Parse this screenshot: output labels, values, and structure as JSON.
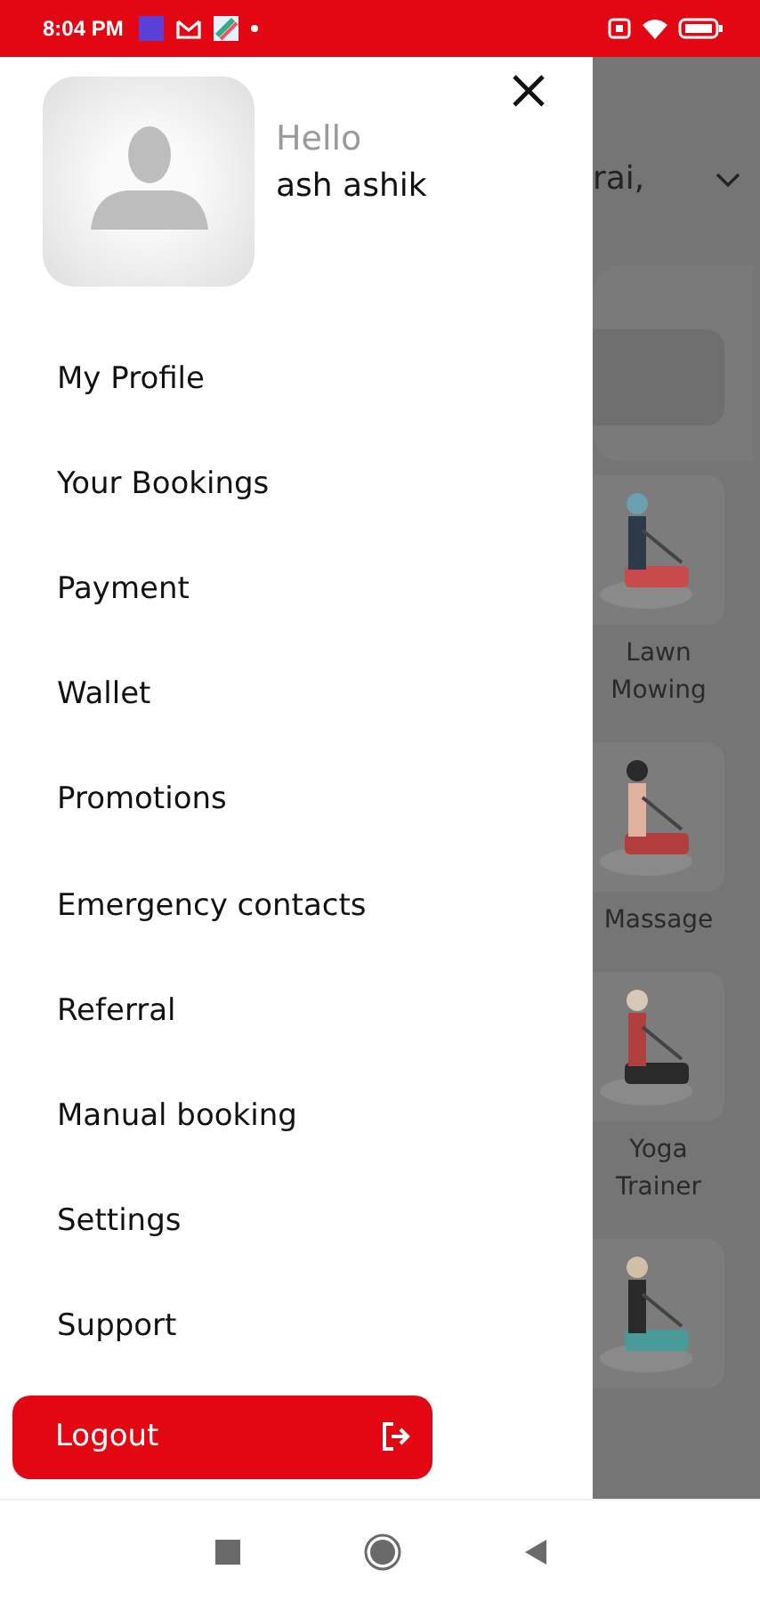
{
  "status_bar": {
    "time": "8:04 PM"
  },
  "drawer": {
    "greeting": "Hello",
    "user_name": "ash ashik",
    "menu_items": [
      {
        "label": "My Profile"
      },
      {
        "label": "Your Bookings"
      },
      {
        "label": "Payment"
      },
      {
        "label": "Wallet"
      },
      {
        "label": "Promotions"
      },
      {
        "label": "Emergency contacts"
      },
      {
        "label": "Referral"
      },
      {
        "label": "Manual booking"
      },
      {
        "label": "Settings"
      },
      {
        "label": "Support"
      }
    ],
    "logout_label": "Logout"
  },
  "background": {
    "location": "rai,",
    "services": [
      {
        "label": "Lawn Mowing",
        "kind": "picture"
      },
      {
        "label": "Massage",
        "kind": "picture"
      },
      {
        "label": "Yoga Trainer",
        "kind": "picture"
      },
      {
        "kind": "picture"
      }
    ]
  }
}
